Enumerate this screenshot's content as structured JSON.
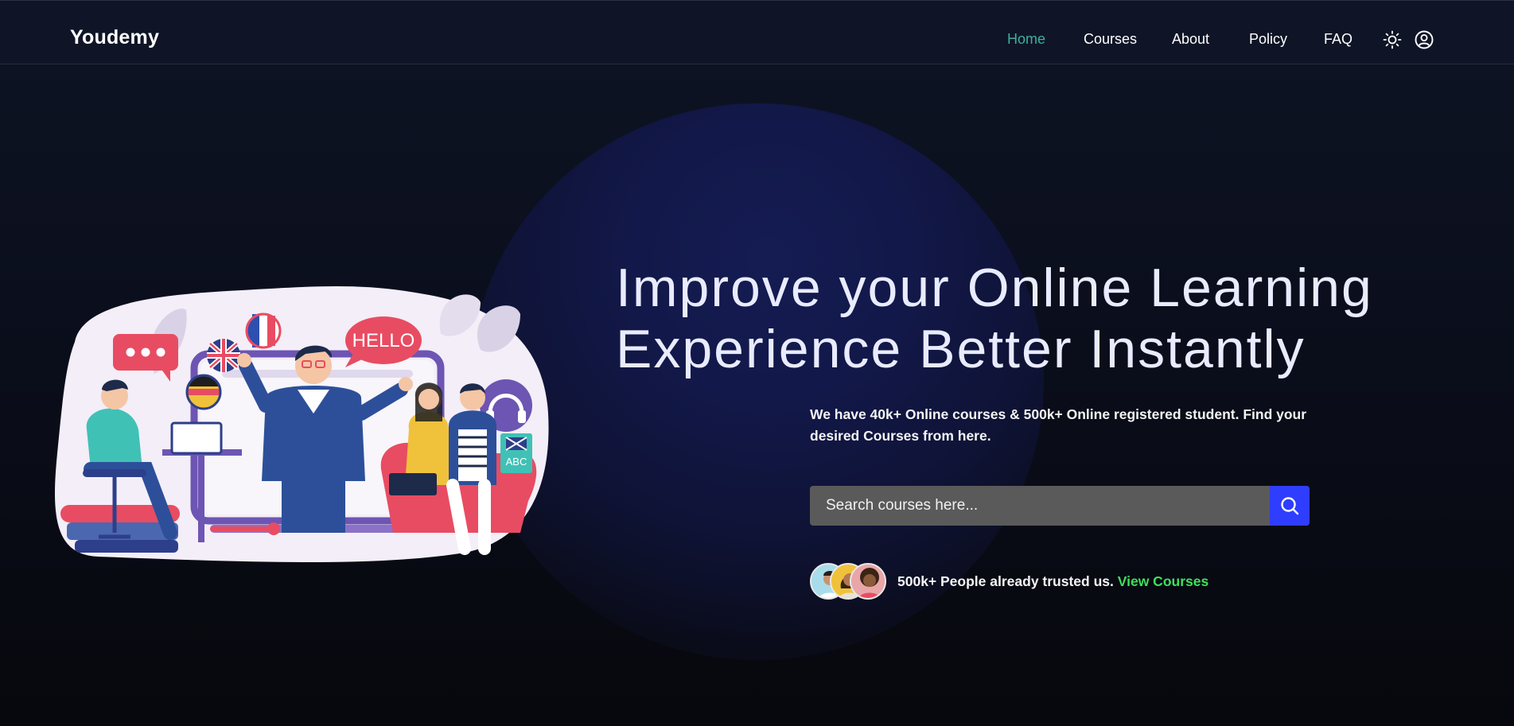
{
  "brand": {
    "name": "Youdemy"
  },
  "nav": {
    "items": [
      {
        "label": "Home",
        "active": true
      },
      {
        "label": "Courses",
        "active": false
      },
      {
        "label": "About",
        "active": false
      },
      {
        "label": "Policy",
        "active": false
      },
      {
        "label": "FAQ",
        "active": false
      }
    ],
    "icons": [
      "sun-icon",
      "user-circle-icon"
    ]
  },
  "hero": {
    "title_line1": "Improve your Online Learning",
    "title_line2": "Experience Better Instantly",
    "description": "We have 40k+ Online courses & 500k+ Online registered student. Find your desired Courses from here.",
    "search": {
      "placeholder": "Search courses here..."
    },
    "trust": {
      "text": "500k+ People already trusted us.",
      "link": "View Courses"
    }
  },
  "illustration": {
    "bubble_text": "HELLO",
    "book_text": "ABC"
  },
  "colors": {
    "background": "#0b0f1c",
    "navbar": "#0f1526",
    "active_nav": "#3fae9c",
    "search_button": "#2f3dff",
    "link": "#3ee05a",
    "title": "#e9ebff"
  }
}
